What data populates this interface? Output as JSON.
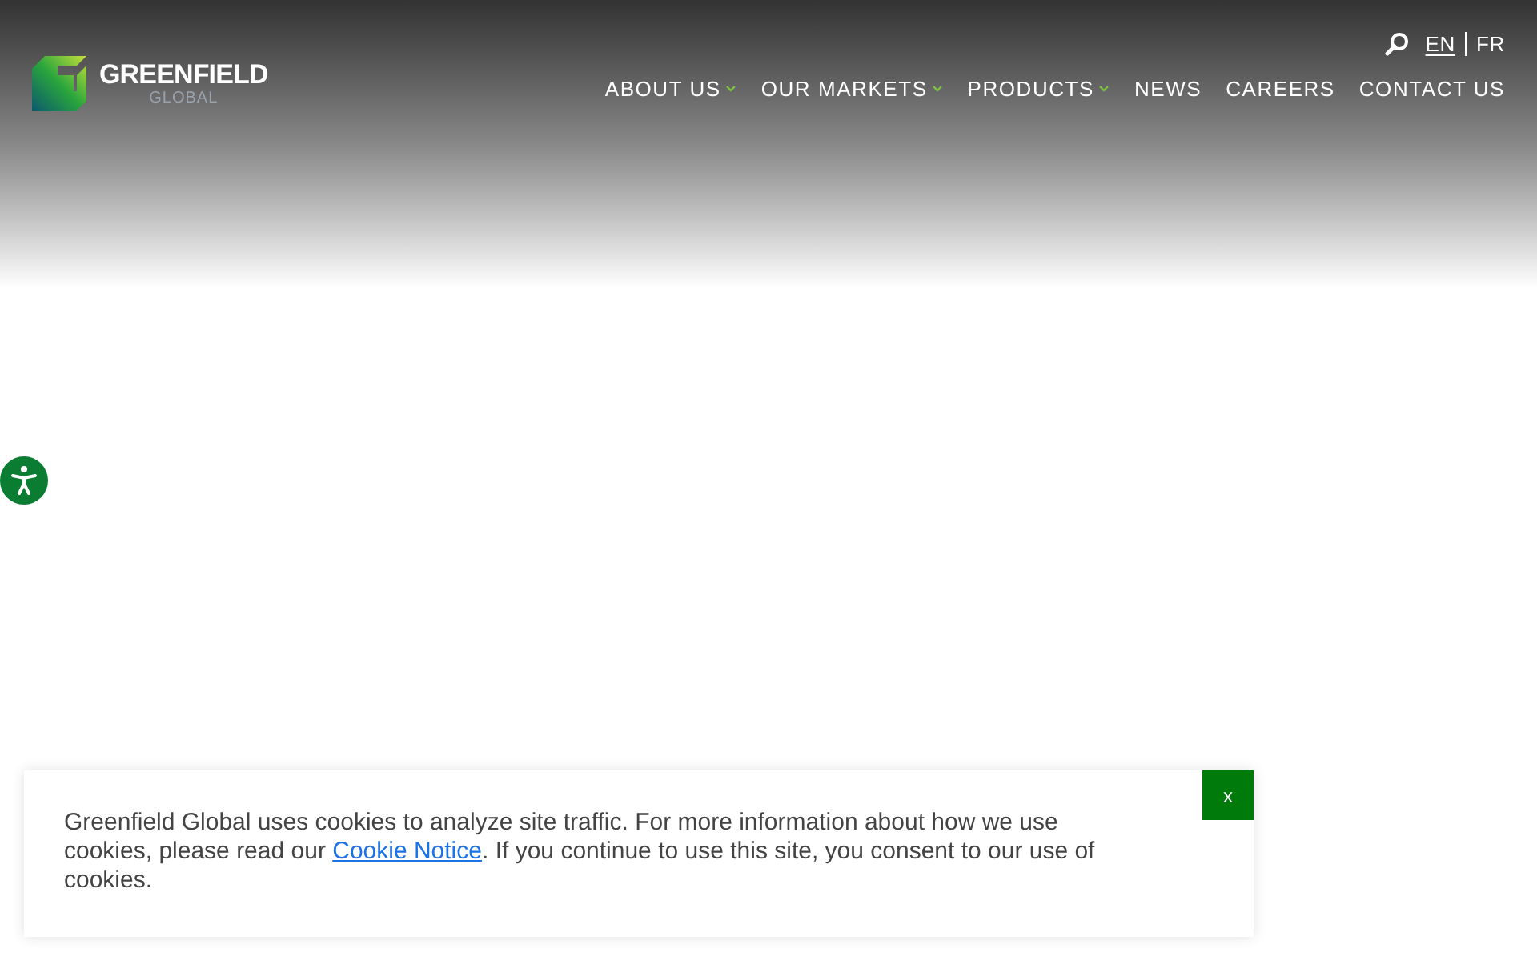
{
  "logo": {
    "name": "GREENFIELD",
    "tagline": "GLOBAL"
  },
  "languages": [
    {
      "label": "EN",
      "selected": true
    },
    {
      "label": "FR",
      "selected": false
    }
  ],
  "nav": [
    {
      "label": "ABOUT US",
      "has_dropdown": true
    },
    {
      "label": "OUR MARKETS",
      "has_dropdown": true
    },
    {
      "label": "PRODUCTS",
      "has_dropdown": true
    },
    {
      "label": "NEWS",
      "has_dropdown": false
    },
    {
      "label": "CAREERS",
      "has_dropdown": false
    },
    {
      "label": "CONTACT US",
      "has_dropdown": false
    }
  ],
  "cookie_banner": {
    "text_before": "Greenfield Global uses cookies to analyze site traffic. For more information about how we use cookies, please read our ",
    "link": "Cookie Notice",
    "text_after": ". If you continue to use this site, you consent to our use of cookies.",
    "close": "x"
  }
}
